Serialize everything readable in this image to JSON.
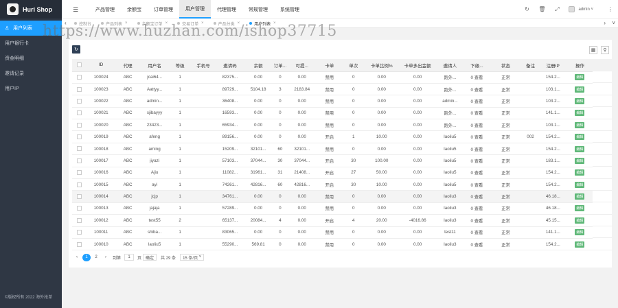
{
  "app": {
    "title": "Huri Shop",
    "copyright": "©版权所有 2022 海外抢单"
  },
  "sidebar": {
    "items": [
      {
        "label": "用户列表",
        "icon": "users-icon",
        "active": true
      },
      {
        "label": "用户银行卡"
      },
      {
        "label": "资金明细"
      },
      {
        "label": "邀请记录"
      },
      {
        "label": "用户IP"
      }
    ]
  },
  "header": {
    "nav": [
      "产品管理",
      "余额宝",
      "订单管理",
      "用户管理",
      "代理管理",
      "常规管理",
      "系统管理"
    ],
    "active_nav": "用户管理",
    "user": "admin"
  },
  "tabs": [
    "控制台",
    "产品列表",
    "余额宝订单",
    "交易订单",
    "产品分类",
    "用户列表"
  ],
  "watermark": "https://www.huzhan.com/ishop37715",
  "table": {
    "columns": [
      "ID",
      "代理",
      "用户名",
      "等级",
      "手机号",
      "邀请码",
      "余额",
      "订单...",
      "可提...",
      "卡单",
      "单次",
      "卡单比例%",
      "卡单多出金额",
      "邀请人",
      "下级...",
      "状态",
      "备注",
      "注册IP",
      "操作"
    ],
    "edit_label": "编辑",
    "rows": [
      [
        "100024",
        "ABC",
        "jcai64...",
        "1",
        "",
        "82375...",
        "0.00",
        "0",
        "0.00",
        "禁用",
        "0",
        "0.00",
        "0.00",
        "跑外...",
        "0 查看",
        "正常",
        "",
        "154.2..."
      ],
      [
        "100023",
        "ABC",
        "Aattyy...",
        "1",
        "",
        "89729...",
        "5104.18",
        "3",
        "2183.84",
        "禁用",
        "0",
        "0.00",
        "0.00",
        "跑外...",
        "0 查看",
        "正常",
        "",
        "103.1..."
      ],
      [
        "100022",
        "ABC",
        "admin...",
        "1",
        "",
        "36408...",
        "0.00",
        "0",
        "0.00",
        "禁用",
        "0",
        "0.00",
        "0.00",
        "admin...",
        "0 查看",
        "正常",
        "",
        "103.2..."
      ],
      [
        "100021",
        "ABC",
        "sjibayyy",
        "1",
        "",
        "16593...",
        "0.00",
        "0",
        "0.00",
        "禁用",
        "0",
        "0.00",
        "0.00",
        "跑外...",
        "0 查看",
        "正常",
        "",
        "141.1..."
      ],
      [
        "100020",
        "ABC",
        "23423...",
        "1",
        "",
        "65934...",
        "0.00",
        "0",
        "0.00",
        "禁用",
        "0",
        "0.00",
        "0.00",
        "跑外...",
        "0 查看",
        "正常",
        "",
        "103.1..."
      ],
      [
        "100019",
        "ABC",
        "afeng",
        "1",
        "",
        "89156...",
        "0.00",
        "0",
        "0.00",
        "开启",
        "1",
        "10.00",
        "0.00",
        "laoliu5",
        "0 查看",
        "正常",
        "002",
        "154.2..."
      ],
      [
        "100018",
        "ABC",
        "aming",
        "1",
        "",
        "15209...",
        "32101...",
        "60",
        "32101...",
        "禁用",
        "0",
        "0.00",
        "0.00",
        "laoliu5",
        "0 查看",
        "正常",
        "",
        "154.2..."
      ],
      [
        "100017",
        "ABC",
        "jiyazi",
        "1",
        "",
        "57103...",
        "37044...",
        "30",
        "37044...",
        "开启",
        "30",
        "100.00",
        "0.00",
        "laoliu5",
        "0 查看",
        "正常",
        "",
        "183.1..."
      ],
      [
        "100016",
        "ABC",
        "Ajiu",
        "1",
        "",
        "11082...",
        "31961...",
        "31",
        "21408...",
        "开启",
        "27",
        "50.00",
        "0.00",
        "laoliu5",
        "0 查看",
        "正常",
        "",
        "154.2..."
      ],
      [
        "100015",
        "ABC",
        "ayi",
        "1",
        "",
        "74261...",
        "42816...",
        "60",
        "42816...",
        "开启",
        "30",
        "10.00",
        "0.00",
        "laoliu5",
        "0 查看",
        "正常",
        "",
        "154.2..."
      ],
      [
        "100014",
        "ABC",
        "jcjp",
        "1",
        "",
        "34761...",
        "0.00",
        "0",
        "0.00",
        "禁用",
        "0",
        "0.00",
        "0.00",
        "laoliu3",
        "0 查看",
        "正常",
        "",
        "46.18..."
      ],
      [
        "100013",
        "ABC",
        "jajaja",
        "1",
        "",
        "57289...",
        "0.00",
        "0",
        "0.00",
        "禁用",
        "0",
        "0.00",
        "0.00",
        "laoliu3",
        "0 查看",
        "正常",
        "",
        "46.18..."
      ],
      [
        "100012",
        "ABC",
        "test55",
        "2",
        "",
        "65137...",
        "20084...",
        "4",
        "0.00",
        "开启",
        "4",
        "20.00",
        "-4016.86",
        "laoliu3",
        "0 查看",
        "正常",
        "",
        "45.15..."
      ],
      [
        "100011",
        "ABC",
        "shiba...",
        "1",
        "",
        "83065...",
        "0.00",
        "0",
        "0.00",
        "禁用",
        "0",
        "0.00",
        "0.00",
        "test11",
        "0 查看",
        "正常",
        "",
        "141.1..."
      ],
      [
        "100010",
        "ABC",
        "laoliu5",
        "1",
        "",
        "55290...",
        "569.81",
        "0",
        "0.00",
        "禁用",
        "0",
        "0.00",
        "0.00",
        "laoliu3",
        "0 查看",
        "正常",
        "",
        "154.2..."
      ]
    ]
  },
  "pagination": {
    "pages": [
      "1",
      "2"
    ],
    "current": "1",
    "goto_label": "到第",
    "goto_value": "1",
    "page_unit": "页",
    "confirm_label": "确定",
    "total_label": "共 29 条",
    "per_page": "15 条/页"
  }
}
